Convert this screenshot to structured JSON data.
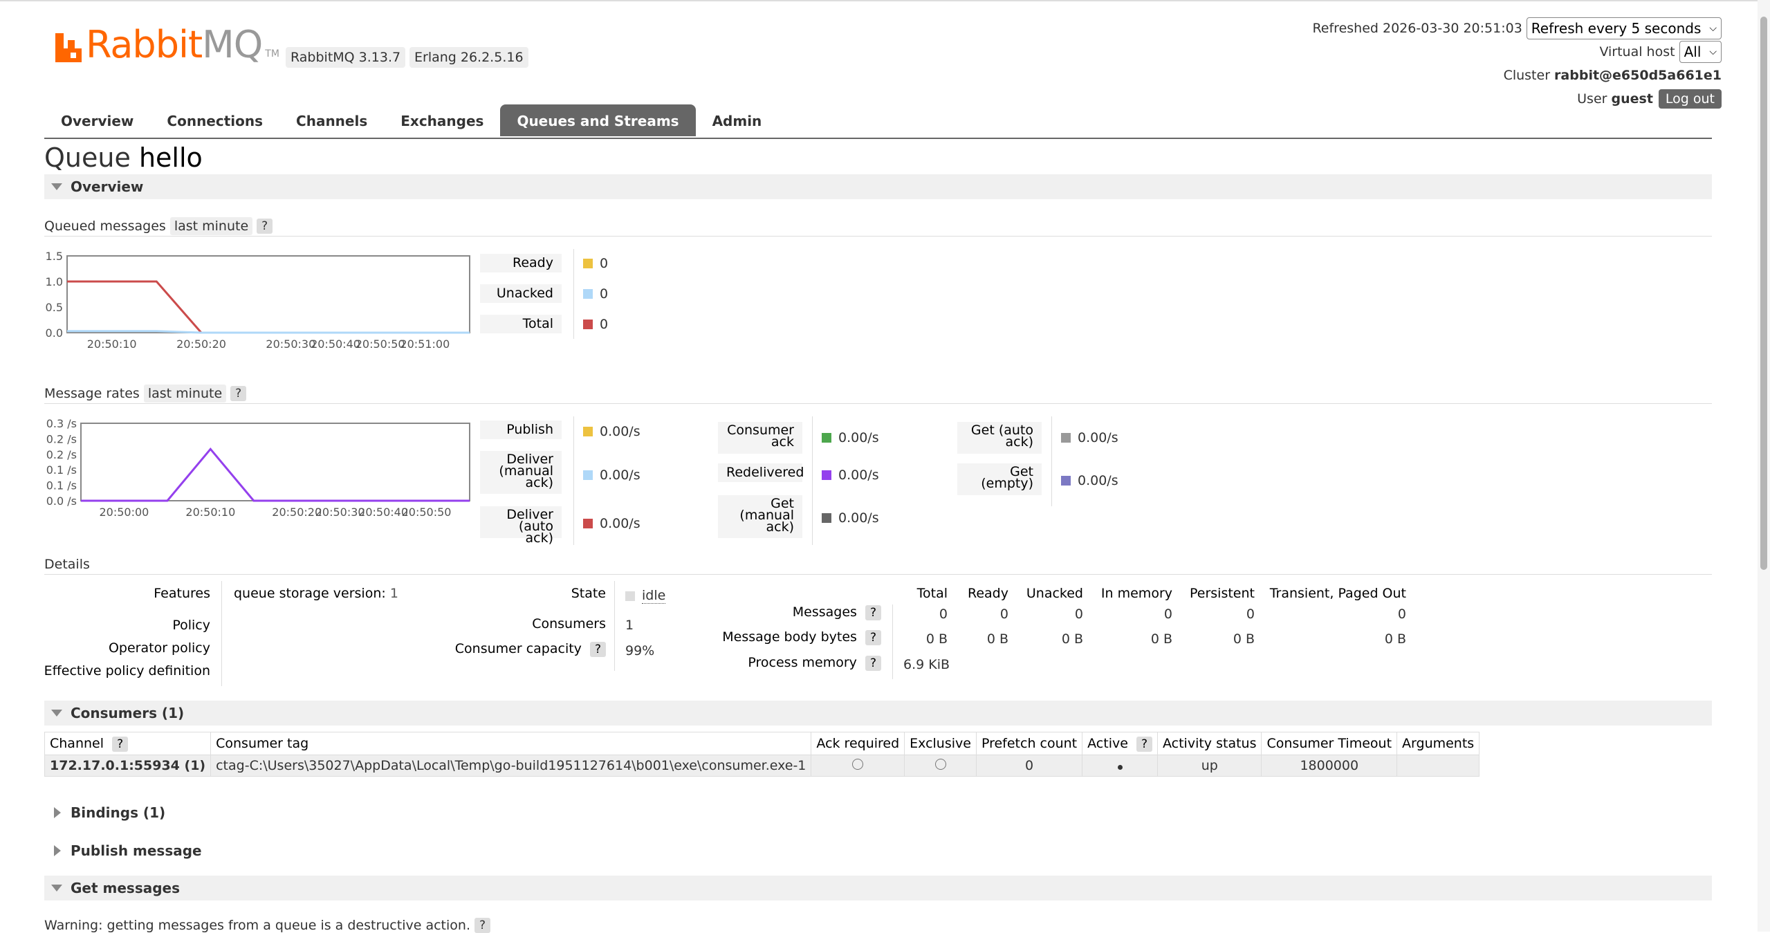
{
  "header": {
    "brand_word_1": "Rabbit",
    "brand_word_2": "MQ",
    "brand_tm": "TM",
    "rabbitmq_version": "RabbitMQ 3.13.7",
    "erlang_version": "Erlang 26.2.5.16",
    "refreshed": "Refreshed 2026-03-30 20:51:03",
    "refresh_select": "Refresh every 5 seconds",
    "vhost_label": "Virtual host",
    "vhost_value": "All",
    "cluster_label": "Cluster",
    "cluster_value": "rabbit@e650d5a661e1",
    "user_label": "User",
    "user_value": "guest",
    "logout": "Log out"
  },
  "tabs": [
    "Overview",
    "Connections",
    "Channels",
    "Exchanges",
    "Queues and Streams",
    "Admin"
  ],
  "active_tab": "Queues and Streams",
  "page_title_prefix": "Queue",
  "page_title_name": "hello",
  "sections": {
    "overview": "Overview",
    "consumers": "Consumers (1)",
    "bindings": "Bindings (1)",
    "publish": "Publish message",
    "get": "Get messages"
  },
  "queued": {
    "label": "Queued messages",
    "range": "last minute",
    "help": "?",
    "legend": [
      {
        "label": "Ready",
        "value": "0",
        "color": "#edc240"
      },
      {
        "label": "Unacked",
        "value": "0",
        "color": "#afd8f8"
      },
      {
        "label": "Total",
        "value": "0",
        "color": "#cb4b4b"
      }
    ]
  },
  "rates": {
    "label": "Message rates",
    "range": "last minute",
    "help": "?",
    "col1": [
      {
        "label": "Publish",
        "value": "0.00/s",
        "color": "#edc240"
      },
      {
        "label": "Deliver\n(manual\nack)",
        "value": "0.00/s",
        "color": "#afd8f8"
      },
      {
        "label": "Deliver\n(auto ack)",
        "value": "0.00/s",
        "color": "#cb4b4b"
      }
    ],
    "col2": [
      {
        "label": "Consumer\nack",
        "value": "0.00/s",
        "color": "#4da74d"
      },
      {
        "label": "Redelivered",
        "value": "0.00/s",
        "color": "#9440ed"
      },
      {
        "label": "Get\n(manual\nack)",
        "value": "0.00/s",
        "color": "#666666"
      }
    ],
    "col3": [
      {
        "label": "Get (auto\nack)",
        "value": "0.00/s",
        "color": "#999999"
      },
      {
        "label": "Get\n(empty)",
        "value": "0.00/s",
        "color": "#7c79c3"
      }
    ]
  },
  "chart_data": [
    {
      "type": "line",
      "x": [
        "20:50:05",
        "20:50:10",
        "20:50:15",
        "20:50:20",
        "20:50:25",
        "20:50:30",
        "20:50:40",
        "20:50:50",
        "20:51:00",
        "20:51:03"
      ],
      "xticks": [
        "20:50:10",
        "20:50:20",
        "20:50:30",
        "20:50:40",
        "20:50:50",
        "20:51:00"
      ],
      "yticks": [
        "1.5",
        "1.0",
        "0.5",
        "0.0"
      ],
      "ylim": [
        0,
        1.5
      ],
      "series": [
        {
          "color": "#cb4b4b",
          "values": [
            1,
            1,
            1,
            0,
            0,
            0,
            0,
            0,
            0,
            0
          ]
        },
        {
          "color": "#afd8f8",
          "values": [
            0.03,
            0.03,
            0.03,
            0,
            0,
            0,
            0,
            0,
            0,
            0
          ]
        }
      ]
    },
    {
      "type": "line",
      "x": [
        "20:49:55",
        "20:50:00",
        "20:50:05",
        "20:50:10",
        "20:50:15",
        "20:50:20",
        "20:50:30",
        "20:50:40",
        "20:50:50",
        "20:50:58"
      ],
      "xticks": [
        "20:50:00",
        "20:50:10",
        "20:50:20",
        "20:50:30",
        "20:50:40",
        "20:50:50"
      ],
      "yticks": [
        "0.3 /s",
        "0.2 /s",
        "0.2 /s",
        "0.1 /s",
        "0.1 /s",
        "0.0 /s"
      ],
      "ylim": [
        0,
        0.3
      ],
      "series": [
        {
          "color": "#9440ed",
          "values": [
            0,
            0,
            0,
            0.2,
            0,
            0,
            0,
            0,
            0,
            0
          ]
        }
      ]
    }
  ],
  "details": {
    "title": "Details",
    "features_label": "Features",
    "features_key": "queue storage version:",
    "features_val": "1",
    "policy_label": "Policy",
    "operator_policy_label": "Operator policy",
    "effective_policy_label": "Effective policy definition",
    "state_label": "State",
    "state_value": "idle",
    "consumers_label": "Consumers",
    "consumers_value": "1",
    "capacity_label": "Consumer capacity",
    "capacity_value": "99%",
    "help": "?",
    "columns": [
      "Total",
      "Ready",
      "Unacked",
      "In memory",
      "Persistent",
      "Transient, Paged Out"
    ],
    "messages_label": "Messages",
    "messages": [
      "0",
      "0",
      "0",
      "0",
      "0",
      "0"
    ],
    "body_label": "Message body bytes",
    "body": [
      "0 B",
      "0 B",
      "0 B",
      "0 B",
      "0 B",
      "0 B"
    ],
    "memory_label": "Process memory",
    "memory": "6.9 KiB"
  },
  "consumers_table": {
    "headers": [
      "Channel",
      "Consumer tag",
      "Ack required",
      "Exclusive",
      "Prefetch count",
      "Active",
      "Activity status",
      "Consumer Timeout",
      "Arguments"
    ],
    "row": {
      "channel": "172.17.0.1:55934 (1)",
      "tag": "ctag-C:\\Users\\35027\\AppData\\Local\\Temp\\go-build1951127614\\b001\\exe\\consumer.exe-1",
      "prefetch": "0",
      "status": "up",
      "timeout": "1800000"
    }
  },
  "get_warning": "Warning: getting messages from a queue is a destructive action."
}
